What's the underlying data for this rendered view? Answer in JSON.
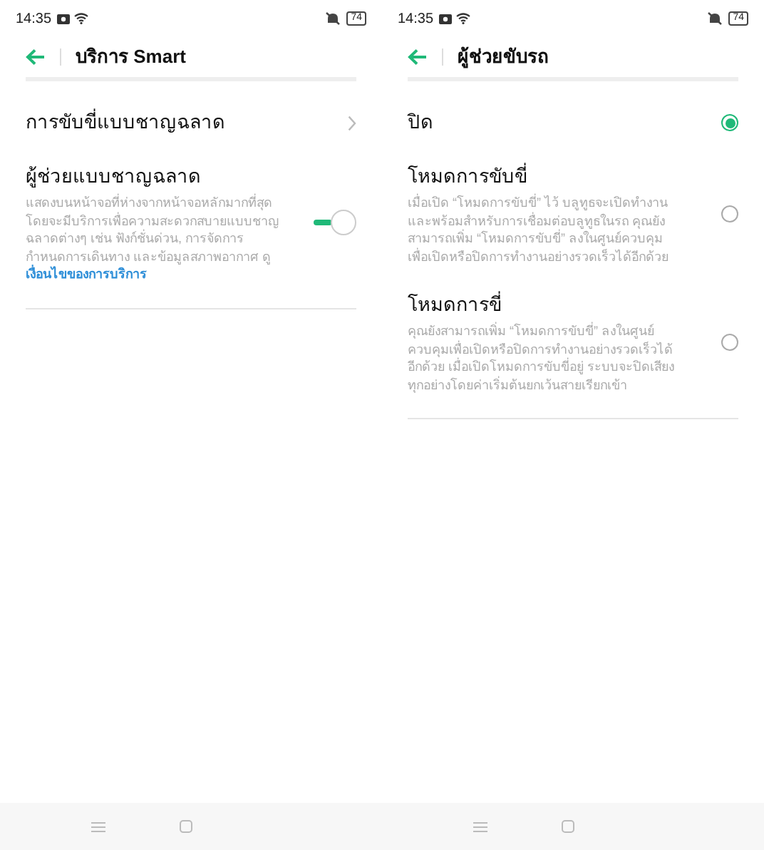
{
  "screens": [
    {
      "status_bar": {
        "time": "14:35",
        "battery": "74"
      },
      "header": {
        "title": "บริการ Smart"
      },
      "items": [
        {
          "kind": "link",
          "title": "การขับขี่แบบชาญฉลาด"
        },
        {
          "kind": "toggle",
          "title": "ผู้ช่วยแบบชาญฉลาด",
          "description": "แสดงบนหน้าจอที่ห่างจากหน้าจอหลักมากที่สุด โดยจะมีบริการเพื่อความสะดวกสบายแบบชาญฉลาดต่างๆ เช่น ฟังก์ชั่นด่วน, การจัดการกำหนดการเดินทาง และข้อมูลสภาพอากาศ ดู",
          "link": "เงื่อนไขของการบริการ",
          "on": true
        }
      ]
    },
    {
      "status_bar": {
        "time": "14:35",
        "battery": "74"
      },
      "header": {
        "title": "ผู้ช่วยขับรถ"
      },
      "items": [
        {
          "kind": "radio",
          "title": "ปิด",
          "selected": true
        },
        {
          "kind": "radio",
          "title": "โหมดการขับขี่",
          "description": "เมื่อเปิด “โหมดการขับขี่” ไว้ บลูทูธจะเปิดทำงาน และพร้อมสำหรับการเชื่อมต่อบลูทูธในรถ คุณยังสามารถเพิ่ม “โหมดการขับขี่” ลงในศูนย์ควบคุมเพื่อเปิดหรือปิดการทำงานอย่างรวดเร็วได้อีกด้วย",
          "selected": false
        },
        {
          "kind": "radio",
          "title": "โหมดการขี่",
          "description": "คุณยังสามารถเพิ่ม “โหมดการขับขี่” ลงในศูนย์ควบคุมเพื่อเปิดหรือปิดการทำงานอย่างรวดเร็วได้อีกด้วย เมื่อเปิดโหมดการขับขี่อยู่ ระบบจะปิดเสียงทุกอย่างโดยค่าเริ่มต้นยกเว้นสายเรียกเข้า",
          "selected": false
        }
      ]
    }
  ]
}
